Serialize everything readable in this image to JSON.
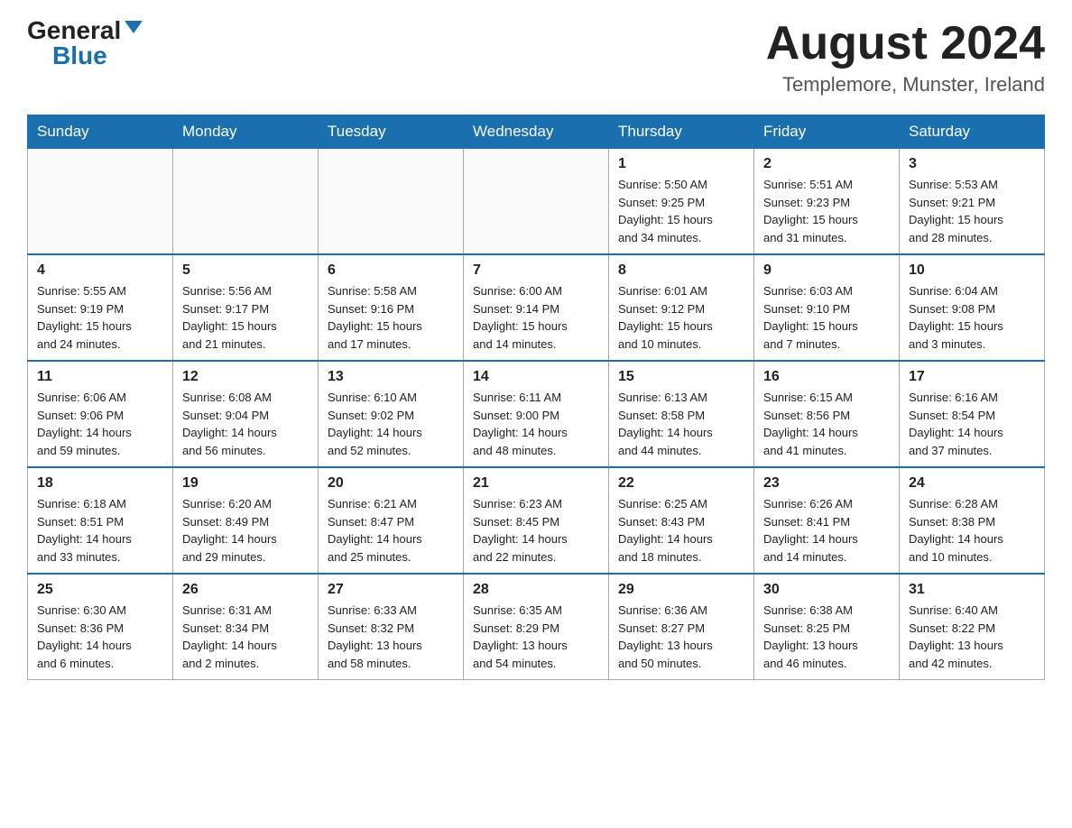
{
  "header": {
    "logo_general": "General",
    "logo_blue": "Blue",
    "month_title": "August 2024",
    "location": "Templemore, Munster, Ireland"
  },
  "weekdays": [
    "Sunday",
    "Monday",
    "Tuesday",
    "Wednesday",
    "Thursday",
    "Friday",
    "Saturday"
  ],
  "weeks": [
    [
      {
        "day": "",
        "info": ""
      },
      {
        "day": "",
        "info": ""
      },
      {
        "day": "",
        "info": ""
      },
      {
        "day": "",
        "info": ""
      },
      {
        "day": "1",
        "info": "Sunrise: 5:50 AM\nSunset: 9:25 PM\nDaylight: 15 hours\nand 34 minutes."
      },
      {
        "day": "2",
        "info": "Sunrise: 5:51 AM\nSunset: 9:23 PM\nDaylight: 15 hours\nand 31 minutes."
      },
      {
        "day": "3",
        "info": "Sunrise: 5:53 AM\nSunset: 9:21 PM\nDaylight: 15 hours\nand 28 minutes."
      }
    ],
    [
      {
        "day": "4",
        "info": "Sunrise: 5:55 AM\nSunset: 9:19 PM\nDaylight: 15 hours\nand 24 minutes."
      },
      {
        "day": "5",
        "info": "Sunrise: 5:56 AM\nSunset: 9:17 PM\nDaylight: 15 hours\nand 21 minutes."
      },
      {
        "day": "6",
        "info": "Sunrise: 5:58 AM\nSunset: 9:16 PM\nDaylight: 15 hours\nand 17 minutes."
      },
      {
        "day": "7",
        "info": "Sunrise: 6:00 AM\nSunset: 9:14 PM\nDaylight: 15 hours\nand 14 minutes."
      },
      {
        "day": "8",
        "info": "Sunrise: 6:01 AM\nSunset: 9:12 PM\nDaylight: 15 hours\nand 10 minutes."
      },
      {
        "day": "9",
        "info": "Sunrise: 6:03 AM\nSunset: 9:10 PM\nDaylight: 15 hours\nand 7 minutes."
      },
      {
        "day": "10",
        "info": "Sunrise: 6:04 AM\nSunset: 9:08 PM\nDaylight: 15 hours\nand 3 minutes."
      }
    ],
    [
      {
        "day": "11",
        "info": "Sunrise: 6:06 AM\nSunset: 9:06 PM\nDaylight: 14 hours\nand 59 minutes."
      },
      {
        "day": "12",
        "info": "Sunrise: 6:08 AM\nSunset: 9:04 PM\nDaylight: 14 hours\nand 56 minutes."
      },
      {
        "day": "13",
        "info": "Sunrise: 6:10 AM\nSunset: 9:02 PM\nDaylight: 14 hours\nand 52 minutes."
      },
      {
        "day": "14",
        "info": "Sunrise: 6:11 AM\nSunset: 9:00 PM\nDaylight: 14 hours\nand 48 minutes."
      },
      {
        "day": "15",
        "info": "Sunrise: 6:13 AM\nSunset: 8:58 PM\nDaylight: 14 hours\nand 44 minutes."
      },
      {
        "day": "16",
        "info": "Sunrise: 6:15 AM\nSunset: 8:56 PM\nDaylight: 14 hours\nand 41 minutes."
      },
      {
        "day": "17",
        "info": "Sunrise: 6:16 AM\nSunset: 8:54 PM\nDaylight: 14 hours\nand 37 minutes."
      }
    ],
    [
      {
        "day": "18",
        "info": "Sunrise: 6:18 AM\nSunset: 8:51 PM\nDaylight: 14 hours\nand 33 minutes."
      },
      {
        "day": "19",
        "info": "Sunrise: 6:20 AM\nSunset: 8:49 PM\nDaylight: 14 hours\nand 29 minutes."
      },
      {
        "day": "20",
        "info": "Sunrise: 6:21 AM\nSunset: 8:47 PM\nDaylight: 14 hours\nand 25 minutes."
      },
      {
        "day": "21",
        "info": "Sunrise: 6:23 AM\nSunset: 8:45 PM\nDaylight: 14 hours\nand 22 minutes."
      },
      {
        "day": "22",
        "info": "Sunrise: 6:25 AM\nSunset: 8:43 PM\nDaylight: 14 hours\nand 18 minutes."
      },
      {
        "day": "23",
        "info": "Sunrise: 6:26 AM\nSunset: 8:41 PM\nDaylight: 14 hours\nand 14 minutes."
      },
      {
        "day": "24",
        "info": "Sunrise: 6:28 AM\nSunset: 8:38 PM\nDaylight: 14 hours\nand 10 minutes."
      }
    ],
    [
      {
        "day": "25",
        "info": "Sunrise: 6:30 AM\nSunset: 8:36 PM\nDaylight: 14 hours\nand 6 minutes."
      },
      {
        "day": "26",
        "info": "Sunrise: 6:31 AM\nSunset: 8:34 PM\nDaylight: 14 hours\nand 2 minutes."
      },
      {
        "day": "27",
        "info": "Sunrise: 6:33 AM\nSunset: 8:32 PM\nDaylight: 13 hours\nand 58 minutes."
      },
      {
        "day": "28",
        "info": "Sunrise: 6:35 AM\nSunset: 8:29 PM\nDaylight: 13 hours\nand 54 minutes."
      },
      {
        "day": "29",
        "info": "Sunrise: 6:36 AM\nSunset: 8:27 PM\nDaylight: 13 hours\nand 50 minutes."
      },
      {
        "day": "30",
        "info": "Sunrise: 6:38 AM\nSunset: 8:25 PM\nDaylight: 13 hours\nand 46 minutes."
      },
      {
        "day": "31",
        "info": "Sunrise: 6:40 AM\nSunset: 8:22 PM\nDaylight: 13 hours\nand 42 minutes."
      }
    ]
  ]
}
